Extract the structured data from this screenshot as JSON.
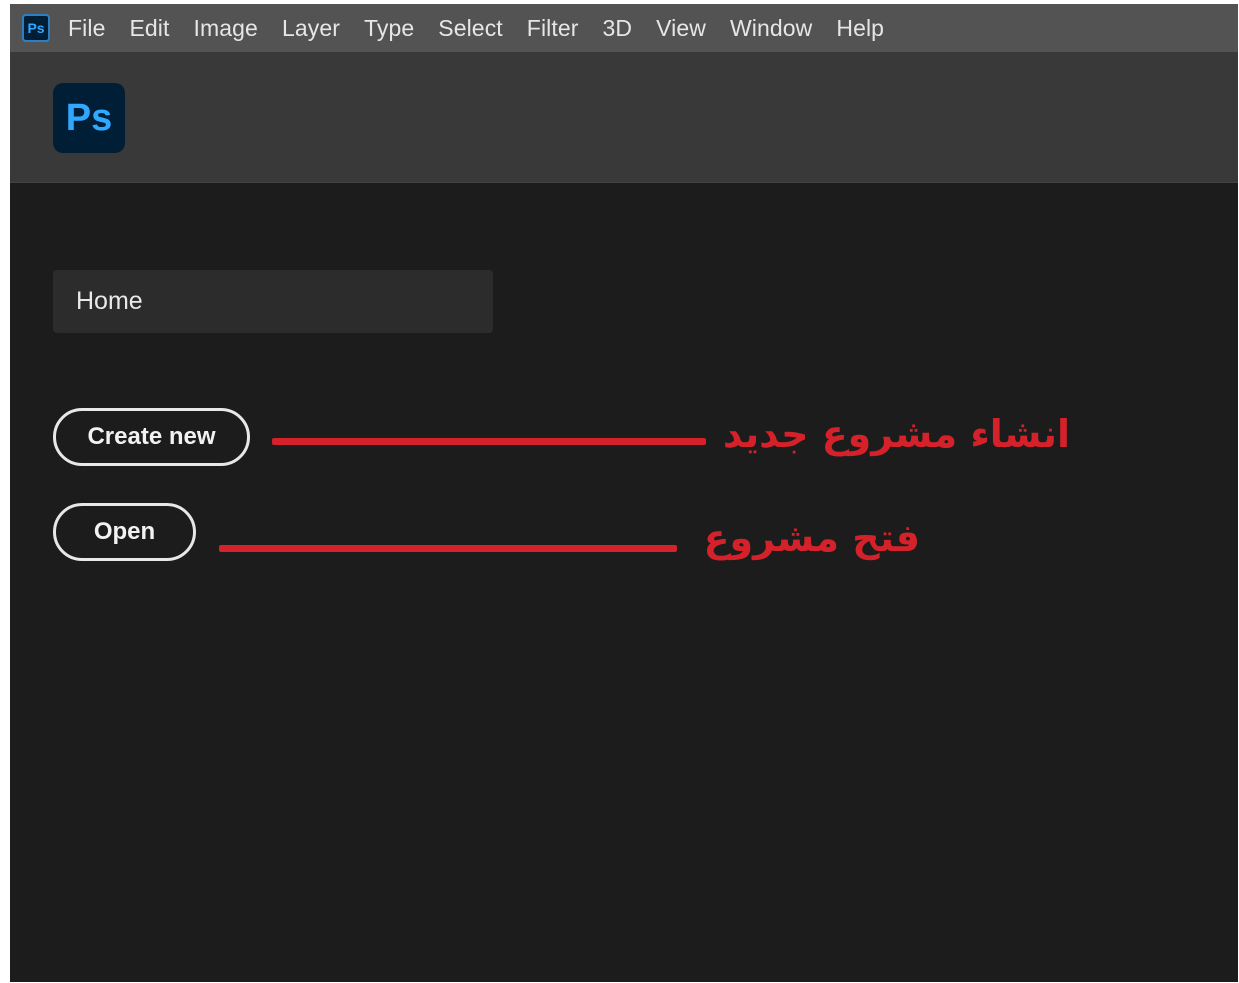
{
  "menubar": {
    "app_icon": "Ps",
    "items": [
      "File",
      "Edit",
      "Image",
      "Layer",
      "Type",
      "Select",
      "Filter",
      "3D",
      "View",
      "Window",
      "Help"
    ]
  },
  "header": {
    "logo": "Ps"
  },
  "home": {
    "tab_label": "Home",
    "create_new_label": "Create new",
    "open_label": "Open"
  },
  "annotations": {
    "create_new_note": "انشاء مشروع جديد",
    "open_note": "فتح مشروع",
    "color": "#d5222a"
  },
  "colors": {
    "ps_blue": "#31a8ff",
    "ps_dark": "#001e36",
    "menubar_bg": "#535353",
    "header_bg": "#393939",
    "canvas_bg": "#1c1c1d"
  }
}
